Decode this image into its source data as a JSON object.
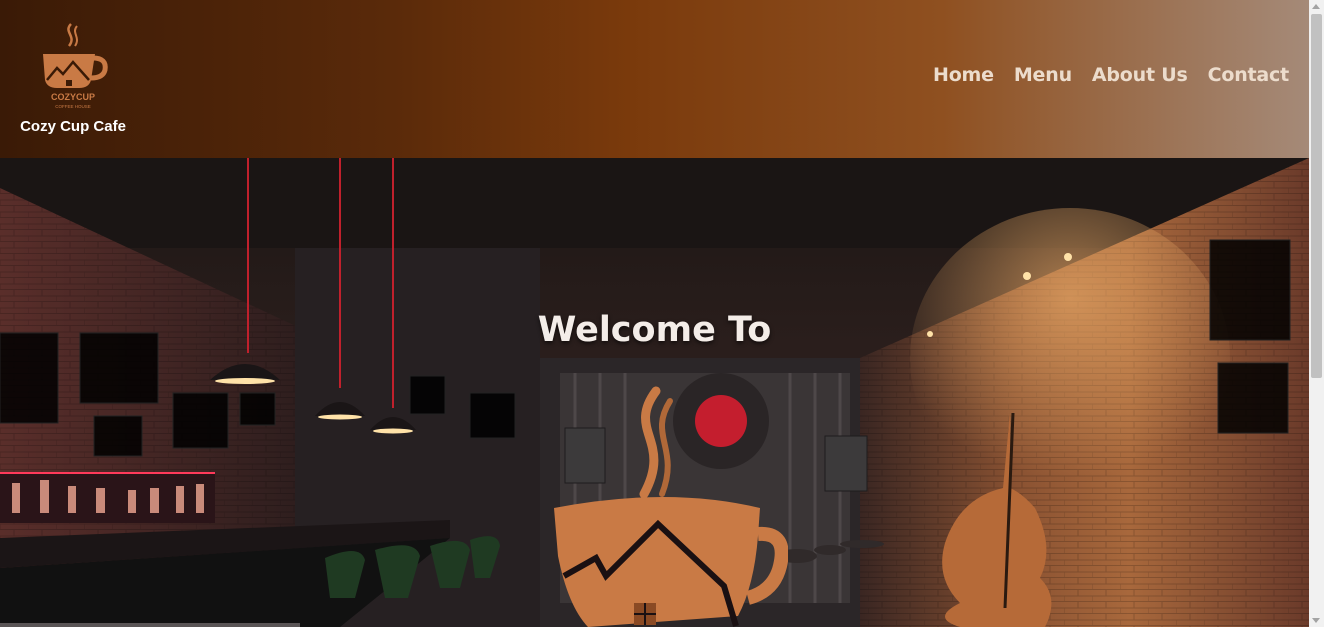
{
  "header": {
    "logo_icon": "coffee-cup-house-logo",
    "logo_wordmark": "COZYCUP",
    "logo_tagline": "COFFEE HOUSE",
    "brand_name": "Cozy Cup Cafe"
  },
  "nav": {
    "items": [
      {
        "label": "Home"
      },
      {
        "label": "Menu"
      },
      {
        "label": "About Us"
      },
      {
        "label": "Contact"
      }
    ]
  },
  "hero": {
    "heading": "Welcome To",
    "logo_icon": "coffee-cup-house-logo"
  },
  "colors": {
    "header_gradient_start": "#3a1a06",
    "header_gradient_mid": "#7a3a0c",
    "header_gradient_end": "#a58a78",
    "nav_text": "#ecdccc",
    "logo_copper": "#c97a45"
  }
}
